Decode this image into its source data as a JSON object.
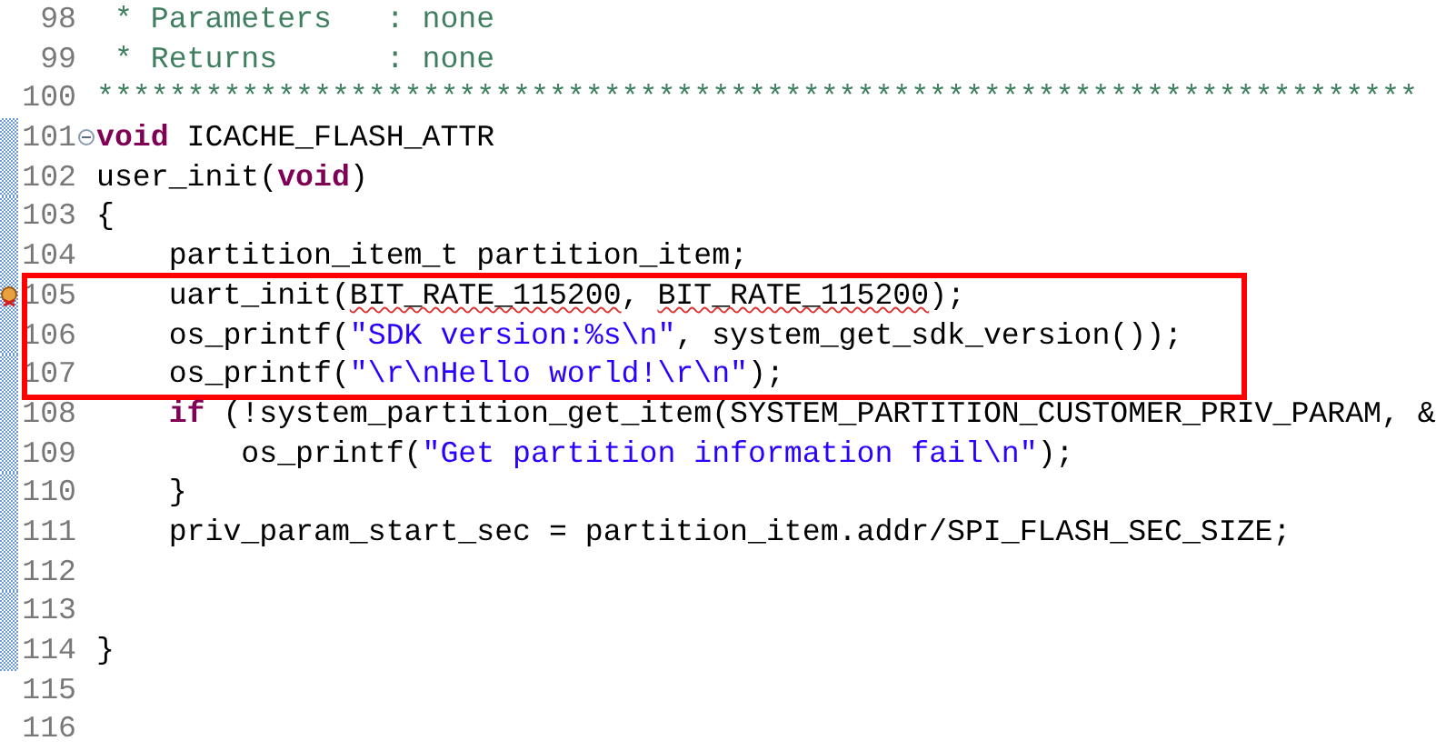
{
  "editor": {
    "lines": [
      {
        "number": "98",
        "kind": "code",
        "in_range": false,
        "boxed": false,
        "tokens": [
          {
            "kind": "comment",
            "text": " * Parameters   : none"
          }
        ]
      },
      {
        "number": "99",
        "kind": "code",
        "in_range": false,
        "boxed": false,
        "tokens": [
          {
            "kind": "comment",
            "text": " * Returns      : none"
          }
        ]
      },
      {
        "number": "100",
        "kind": "code",
        "in_range": false,
        "boxed": false,
        "tokens": [
          {
            "kind": "comment",
            "text": "*************************************************************************"
          }
        ]
      },
      {
        "number": "101",
        "kind": "fold",
        "in_range": true,
        "boxed": false,
        "tokens": [
          {
            "kind": "keyword",
            "text": "void"
          },
          {
            "kind": "plain",
            "text": " ICACHE_FLASH_ATTR"
          }
        ]
      },
      {
        "number": "102",
        "kind": "code",
        "in_range": true,
        "boxed": false,
        "tokens": [
          {
            "kind": "plain",
            "text": "user_init("
          },
          {
            "kind": "keyword",
            "text": "void"
          },
          {
            "kind": "plain",
            "text": ")"
          }
        ]
      },
      {
        "number": "103",
        "kind": "code",
        "in_range": true,
        "boxed": false,
        "tokens": [
          {
            "kind": "plain",
            "text": "{"
          }
        ]
      },
      {
        "number": "104",
        "kind": "code",
        "in_range": true,
        "boxed": false,
        "tokens": [
          {
            "kind": "plain",
            "text": "    partition_item_t partition_item;"
          }
        ]
      },
      {
        "number": "105",
        "kind": "warning",
        "in_range": true,
        "boxed": true,
        "tokens": [
          {
            "kind": "plain",
            "text": "    uart_init(",
            "flagged": false
          },
          {
            "kind": "plain",
            "text": "BIT_RATE_115200",
            "flagged": true
          },
          {
            "kind": "plain",
            "text": ", ",
            "flagged": false
          },
          {
            "kind": "plain",
            "text": "BIT_RATE_115200",
            "flagged": true
          },
          {
            "kind": "plain",
            "text": ");",
            "flagged": false
          }
        ]
      },
      {
        "number": "106",
        "kind": "code",
        "in_range": true,
        "boxed": true,
        "tokens": [
          {
            "kind": "plain",
            "text": "    os_printf("
          },
          {
            "kind": "string",
            "text": "\"SDK version:%s\\n\""
          },
          {
            "kind": "plain",
            "text": ", system_get_sdk_version());"
          }
        ]
      },
      {
        "number": "107",
        "kind": "code",
        "in_range": true,
        "boxed": true,
        "tokens": [
          {
            "kind": "plain",
            "text": "    os_printf("
          },
          {
            "kind": "string",
            "text": "\"\\r\\nHello world!\\r\\n\""
          },
          {
            "kind": "plain",
            "text": ");"
          }
        ]
      },
      {
        "number": "108",
        "kind": "code",
        "in_range": true,
        "boxed": false,
        "tokens": [
          {
            "kind": "keyword",
            "text": "    if"
          },
          {
            "kind": "plain",
            "text": " (!system_partition_get_item(SYSTEM_PARTITION_CUSTOMER_PRIV_PARAM, &"
          }
        ]
      },
      {
        "number": "109",
        "kind": "code",
        "in_range": true,
        "boxed": false,
        "tokens": [
          {
            "kind": "plain",
            "text": "        os_printf("
          },
          {
            "kind": "string",
            "text": "\"Get partition information fail\\n\""
          },
          {
            "kind": "plain",
            "text": ");"
          }
        ]
      },
      {
        "number": "110",
        "kind": "code",
        "in_range": true,
        "boxed": false,
        "tokens": [
          {
            "kind": "plain",
            "text": "    }"
          }
        ]
      },
      {
        "number": "111",
        "kind": "code",
        "in_range": true,
        "boxed": false,
        "tokens": [
          {
            "kind": "plain",
            "text": "    priv_param_start_sec = partition_item.addr/SPI_FLASH_SEC_SIZE;"
          }
        ]
      },
      {
        "number": "112",
        "kind": "code",
        "in_range": true,
        "boxed": false
      },
      {
        "number": "113",
        "kind": "code",
        "in_range": true,
        "boxed": false
      },
      {
        "number": "114",
        "kind": "code",
        "in_range": true,
        "boxed": false,
        "tokens": [
          {
            "kind": "plain",
            "text": "}"
          }
        ]
      },
      {
        "number": "115",
        "kind": "code",
        "in_range": false,
        "boxed": false
      },
      {
        "number": "116",
        "kind": "code",
        "in_range": false,
        "boxed": false
      }
    ]
  }
}
